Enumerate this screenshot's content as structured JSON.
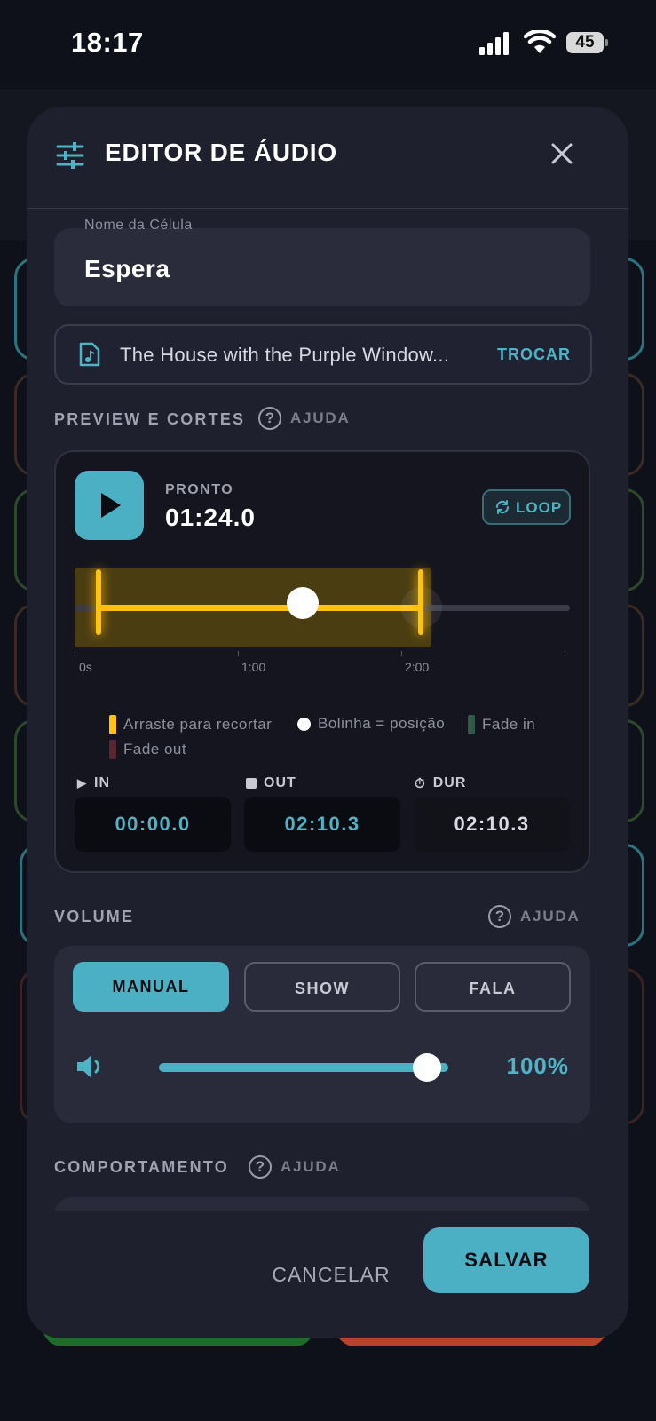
{
  "status_bar": {
    "time": "18:17",
    "battery": "45"
  },
  "modal": {
    "title": "EDITOR DE ÁUDIO",
    "cell_name": {
      "label": "Nome da Célula",
      "value": "Espera"
    },
    "file": {
      "name": "The House with the Purple Window...",
      "action": "TROCAR"
    },
    "preview": {
      "section_label": "PREVIEW E CORTES",
      "help_label": "AJUDA",
      "status": "PRONTO",
      "position": "01:24.0",
      "loop_label": "LOOP",
      "timeline": {
        "tick_labels": [
          "0s",
          "1:00",
          "2:00"
        ],
        "playhead_fraction": 0.46
      },
      "legend": {
        "trim": "Arraste para recortar",
        "position": "Bolinha = posição",
        "fade_in": "Fade in",
        "fade_out": "Fade out"
      },
      "in": {
        "label": "IN",
        "value": "00:00.0"
      },
      "out": {
        "label": "OUT",
        "value": "02:10.3"
      },
      "dur": {
        "label": "DUR",
        "value": "02:10.3"
      }
    },
    "volume": {
      "section_label": "VOLUME",
      "help_label": "AJUDA",
      "modes": [
        "MANUAL",
        "SHOW",
        "FALA"
      ],
      "selected_mode": "MANUAL",
      "level_percent": 100,
      "value_label": "100%"
    },
    "behaviour": {
      "section_label": "COMPORTAMENTO",
      "help_label": "AJUDA"
    },
    "actions": {
      "cancel": "CANCELAR",
      "save": "SALVAR"
    }
  },
  "colors": {
    "accent": "#4bb0c4",
    "trim": "#ffc20e",
    "fade_in": "#2f5a45",
    "fade_out": "#5a2630",
    "modal_bg": "#1f202d"
  }
}
